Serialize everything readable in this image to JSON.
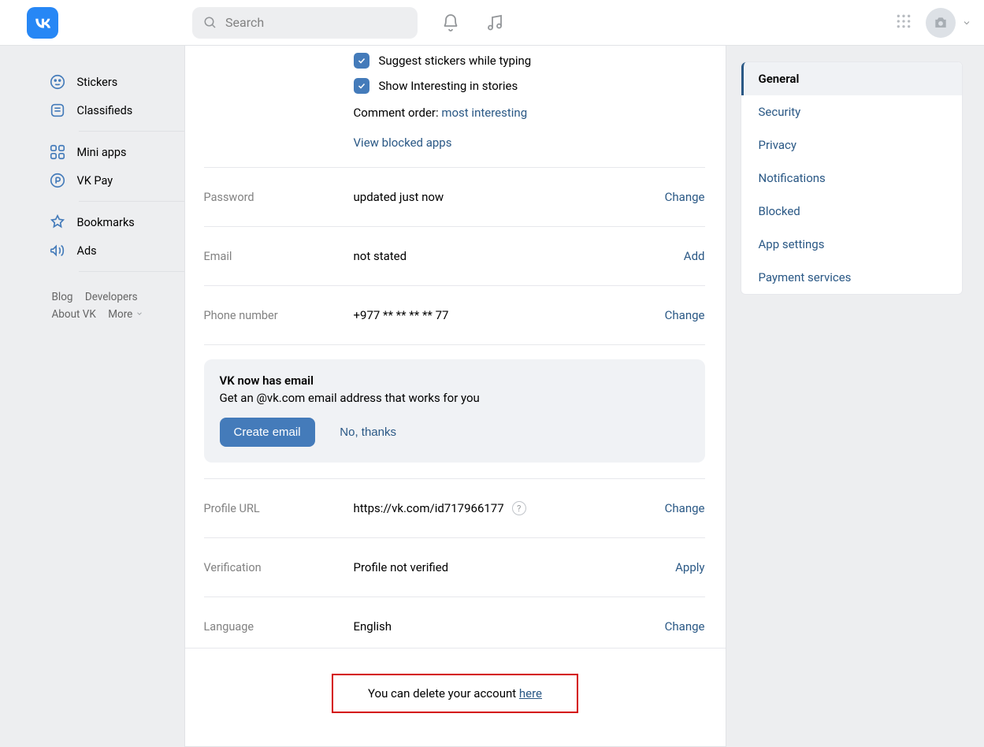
{
  "header": {
    "search_placeholder": "Search"
  },
  "leftnav": {
    "stickers": "Stickers",
    "classifieds": "Classifieds",
    "miniapps": "Mini apps",
    "vkpay": "VK Pay",
    "bookmarks": "Bookmarks",
    "ads": "Ads",
    "blog": "Blog",
    "developers": "Developers",
    "about": "About VK",
    "more": "More"
  },
  "settings": {
    "suggest_stickers": "Suggest stickers while typing",
    "show_interesting": "Show Interesting in stories",
    "comment_order_label": "Comment order: ",
    "comment_order_value": "most interesting",
    "view_blocked": "View blocked apps",
    "password_label": "Password",
    "password_value": "updated just now",
    "email_label": "Email",
    "email_value": "not stated",
    "phone_label": "Phone number",
    "phone_value": "+977 ** ** ** ** 77",
    "change": "Change",
    "add": "Add",
    "apply": "Apply",
    "promo_title": "VK now has email",
    "promo_desc": "Get an @vk.com email address that works for you",
    "create_email": "Create email",
    "no_thanks": "No, thanks",
    "url_label": "Profile URL",
    "url_prefix": "https://vk.com/",
    "url_id": "id717966177",
    "verification_label": "Verification",
    "verification_value": "Profile not verified",
    "language_label": "Language",
    "language_value": "English",
    "delete_text": "You can delete your account ",
    "delete_link": "here"
  },
  "rightnav": {
    "general": "General",
    "security": "Security",
    "privacy": "Privacy",
    "notifications": "Notifications",
    "blocked": "Blocked",
    "appsettings": "App settings",
    "payment": "Payment services"
  }
}
